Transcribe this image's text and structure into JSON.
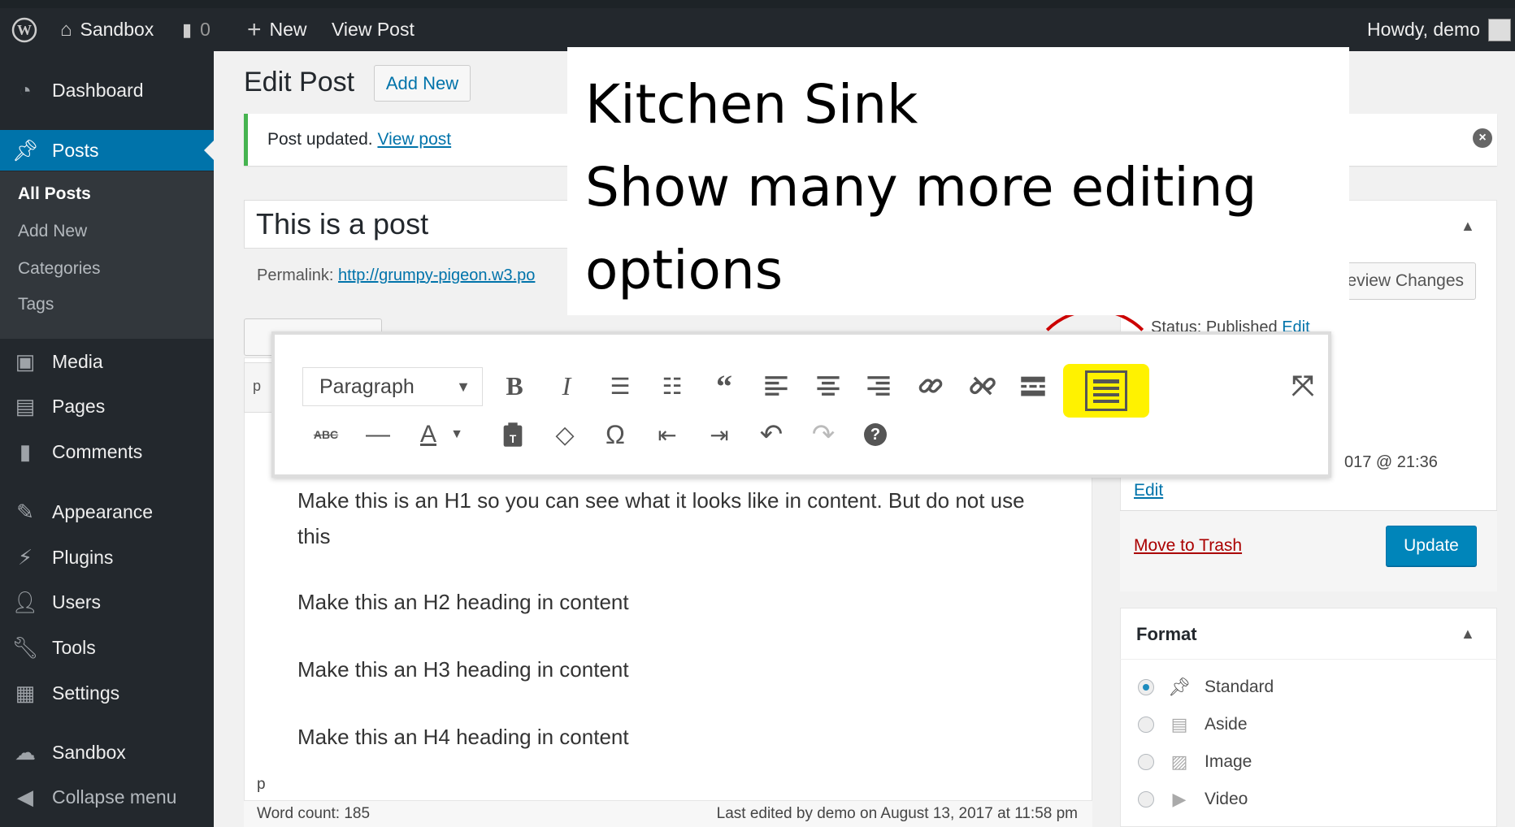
{
  "adminbar": {
    "site_name": "Sandbox",
    "comments_count": "0",
    "new_label": "New",
    "view_post_label": "View Post",
    "howdy": "Howdy, demo"
  },
  "sidebar": {
    "items": [
      {
        "label": "Dashboard",
        "icon": "dashboard-icon"
      },
      {
        "label": "Posts",
        "icon": "pin-icon"
      },
      {
        "label": "Media",
        "icon": "media-icon"
      },
      {
        "label": "Pages",
        "icon": "pages-icon"
      },
      {
        "label": "Comments",
        "icon": "comments-icon"
      },
      {
        "label": "Appearance",
        "icon": "appearance-icon"
      },
      {
        "label": "Plugins",
        "icon": "plugins-icon"
      },
      {
        "label": "Users",
        "icon": "users-icon"
      },
      {
        "label": "Tools",
        "icon": "tools-icon"
      },
      {
        "label": "Settings",
        "icon": "settings-icon"
      },
      {
        "label": "Sandbox",
        "icon": "cloud-icon"
      },
      {
        "label": "Collapse menu",
        "icon": "collapse-icon"
      }
    ],
    "submenu": [
      "All Posts",
      "Add New",
      "Categories",
      "Tags"
    ]
  },
  "page": {
    "heading": "Edit Post",
    "add_new": "Add New",
    "notice_text": "Post updated.",
    "notice_link": "View post",
    "post_title": "This is a post",
    "permalink_label": "Permalink:",
    "permalink_url": "http://grumpy-pigeon.w3.po"
  },
  "editor": {
    "format_select": "Paragraph",
    "quicktag_p": "p",
    "paragraphs": [
      "Make this is an H1 so you can see what it looks like in content. But do not use this",
      "Make this an H2 heading in content",
      "Make this an H3 heading in content",
      "Make this an H4 heading in content"
    ],
    "path": "p",
    "word_count": "Word count: 185",
    "last_edited": "Last edited by demo on August 13, 2017 at 11:58 pm"
  },
  "publish": {
    "preview": "eview Changes",
    "status": "Status: Published",
    "status_edit": "Edit",
    "date": "017 @ 21:36",
    "edit": "Edit",
    "trash": "Move to Trash",
    "update": "Update"
  },
  "format": {
    "title": "Format",
    "options": [
      {
        "label": "Standard",
        "selected": true
      },
      {
        "label": "Aside",
        "selected": false
      },
      {
        "label": "Image",
        "selected": false
      },
      {
        "label": "Video",
        "selected": false
      }
    ]
  },
  "callout": {
    "line1": "Kitchen Sink",
    "line2": "Show many more editing",
    "line3": "options"
  },
  "colors": {
    "adminbar": "#23282d",
    "accent": "#0073aa",
    "highlight": "#fff200",
    "annotation": "#c00000"
  }
}
